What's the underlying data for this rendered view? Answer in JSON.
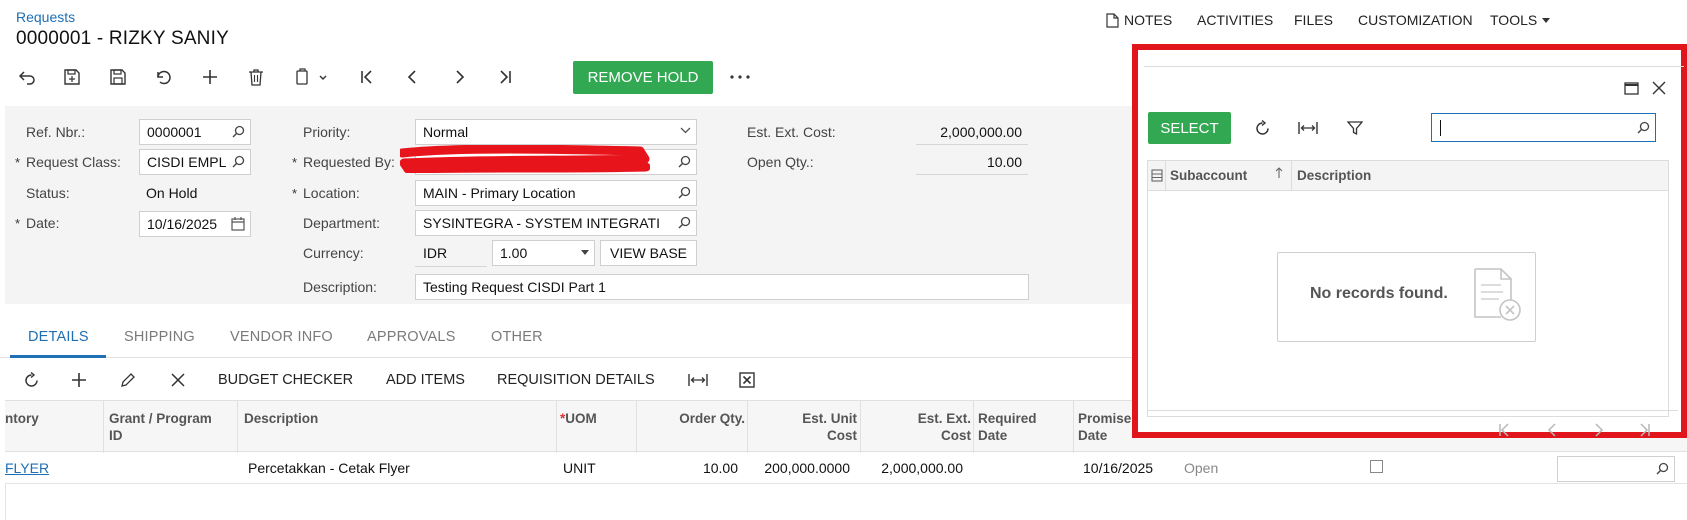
{
  "header": {
    "breadcrumb": "Requests",
    "title": "0000001 - RIZKY SANIY",
    "menu": {
      "notes": "NOTES",
      "activities": "ACTIVITIES",
      "files": "FILES",
      "customization": "CUSTOMIZATION",
      "tools": "TOOLS"
    }
  },
  "toolbar": {
    "remove_hold": "REMOVE HOLD",
    "icons": [
      "undo-icon",
      "save-close-icon",
      "save-icon",
      "cancel-icon",
      "add-icon",
      "delete-icon",
      "copy-paste-icon",
      "first-icon",
      "previous-icon",
      "next-icon",
      "last-icon",
      "more-icon"
    ]
  },
  "form": {
    "ref_nbr": {
      "label": "Ref. Nbr.:",
      "value": "0000001"
    },
    "request_class": {
      "label": "Request Class:",
      "value": "CISDI EMPL"
    },
    "status": {
      "label": "Status:",
      "value": "On Hold"
    },
    "date": {
      "label": "Date:",
      "value": "10/16/2025"
    },
    "priority": {
      "label": "Priority:",
      "value": "Normal"
    },
    "requested_by": {
      "label": "Requested By:",
      "value": ""
    },
    "location": {
      "label": "Location:",
      "value": "MAIN - Primary Location"
    },
    "department": {
      "label": "Department:",
      "value": "SYSINTEGRA - SYSTEM INTEGRATI"
    },
    "currency": {
      "label": "Currency:",
      "code": "IDR",
      "rate": "1.00",
      "view_base": "VIEW BASE"
    },
    "description": {
      "label": "Description:",
      "value": "Testing Request CISDI Part 1"
    },
    "est_ext_cost": {
      "label": "Est. Ext. Cost:",
      "value": "2,000,000.00"
    },
    "open_qty": {
      "label": "Open Qty.:",
      "value": "10.00"
    }
  },
  "tabs": [
    "DETAILS",
    "SHIPPING",
    "VENDOR INFO",
    "APPROVALS",
    "OTHER"
  ],
  "grid_toolbar": {
    "budget_checker": "BUDGET CHECKER",
    "add_items": "ADD ITEMS",
    "requisition_details": "REQUISITION DETAILS"
  },
  "grid": {
    "headers": {
      "inventory": "ntory",
      "grant_1": "Grant / Program",
      "grant_2": "ID",
      "description": "Description",
      "uom": "UOM",
      "order_qty": "Order Qty.",
      "unit_cost_1": "Est. Unit",
      "unit_cost_2": "Cost",
      "ext_cost_1": "Est. Ext.",
      "ext_cost_2": "Cost",
      "required_1": "Required",
      "required_2": "Date",
      "promised_1": "Promise",
      "promised_2": "Date"
    },
    "rows": [
      {
        "inventory": "FLYER",
        "grant": "",
        "description": "Percetakkan - Cetak Flyer",
        "uom": "UNIT",
        "order_qty": "10.00",
        "unit_cost": "200,000.0000",
        "ext_cost": "2,000,000.00",
        "required_date": "",
        "promised_date": "10/16/2025",
        "status": "Open"
      }
    ]
  },
  "popup": {
    "select": "SELECT",
    "search_value": "",
    "columns": {
      "subaccount": "Subaccount",
      "description": "Description"
    },
    "empty": "No records found."
  },
  "colors": {
    "accent": "#1e6fb3",
    "green": "#32a852",
    "highlight": "#e0161c"
  }
}
